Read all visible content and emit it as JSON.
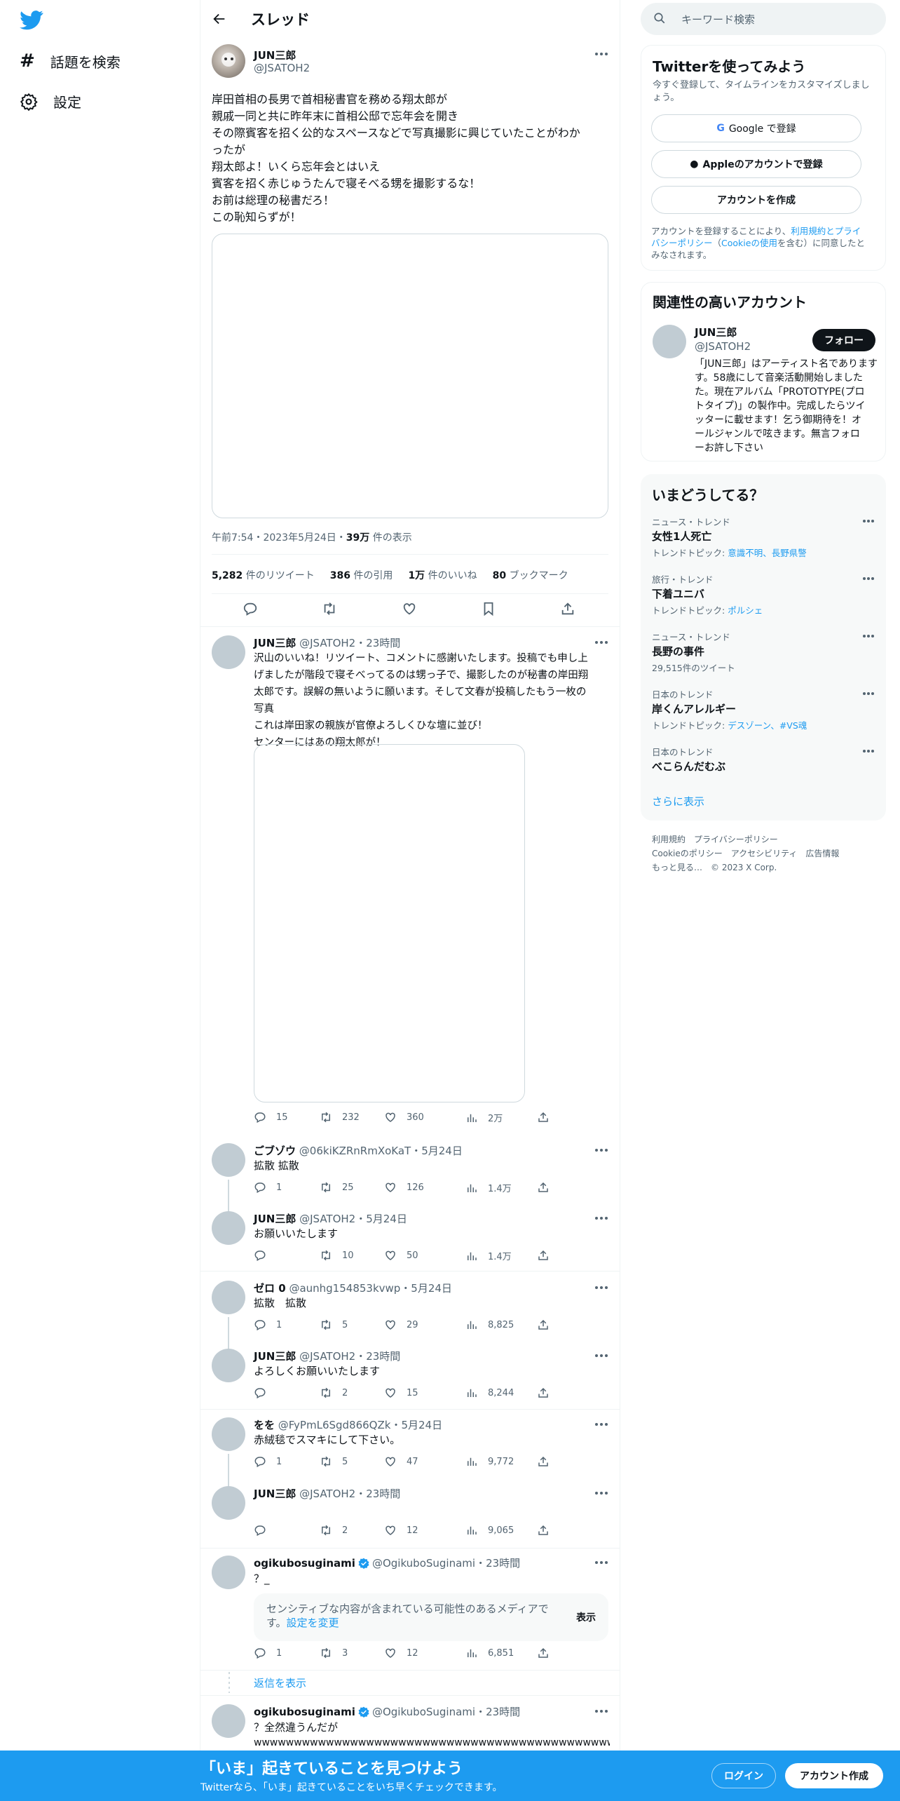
{
  "colors": {
    "accent": "#1d9bf0",
    "text": "#0f1419",
    "muted": "#536471",
    "border": "#eff3f4",
    "bottom_bar": "#1d9bf0"
  },
  "nav": {
    "explore": "話題を検索",
    "settings": "設定"
  },
  "header": {
    "title": "スレッド"
  },
  "main_tweet": {
    "name": "JUN三郎",
    "handle": "@JSATOH2",
    "lines": [
      "岸田首相の長男で首相秘書官を務める翔太郎が",
      "親戚一同と共に昨年末に首相公邸で忘年会を開き",
      "その際賓客を招く公的なスペースなどで写真撮影に興じていたことがわか",
      "ったが",
      "翔太郎よ！いくら忘年会とはいえ",
      "賓客を招く赤じゅうたんで寝そべる甥を撮影するな！",
      "お前は総理の秘書だろ！",
      "この恥知らずが！"
    ],
    "time": "午前7:54・2023年5月24日・",
    "views_num": "39万",
    "views_label": " 件の表示",
    "stats": [
      {
        "num": "5,282",
        "label": " 件のリツイート"
      },
      {
        "num": "386",
        "label": " 件の引用"
      },
      {
        "num": "1万",
        "label": " 件のいいね"
      },
      {
        "num": "80",
        "label": " ブックマーク"
      }
    ]
  },
  "replies": [
    {
      "name": "JUN三郎",
      "meta": "@JSATOH2・23時間",
      "lines": [
        "沢山のいいね！リツイート、コメントに感謝いたします。投稿でも申し上",
        "げましたが階段で寝そべってるのは甥っ子で、撮影したのが秘書の岸田翔",
        "太郎です。誤解の無いように願います。そして文春が投稿したもう一枚の",
        "写真",
        "これは岸田家の親族が官僚よろしくひな壇に並び！",
        "センターにはあの翔太郎が！"
      ],
      "reply": "15",
      "rt": "232",
      "like": "360",
      "views": "2万"
    },
    {
      "name": "ごブゾウ",
      "meta": "@06kiKZRnRmXoKaT・5月24日",
      "lines": [
        "拡散 拡散"
      ],
      "reply": "1",
      "rt": "25",
      "like": "126",
      "views": "1.4万"
    },
    {
      "name": "JUN三郎",
      "meta": "@JSATOH2・5月24日",
      "lines": [
        "お願いいたします"
      ],
      "reply": "",
      "rt": "10",
      "like": "50",
      "views": "1.4万"
    },
    {
      "name": "ゼロ 0",
      "meta": "@aunhg154853kvwp・5月24日",
      "lines": [
        "拡散　拡散"
      ],
      "reply": "1",
      "rt": "5",
      "like": "29",
      "views": "8,825"
    },
    {
      "name": "JUN三郎",
      "meta": "@JSATOH2・23時間",
      "lines": [
        "よろしくお願いいたします"
      ],
      "reply": "",
      "rt": "2",
      "like": "15",
      "views": "8,244"
    },
    {
      "name": "をを",
      "meta": "@FyPmL6Sgd866QZk・5月24日",
      "lines": [
        "赤絨毯でスマキにして下さい。"
      ],
      "reply": "1",
      "rt": "5",
      "like": "47",
      "views": "9,772"
    },
    {
      "name": "JUN三郎",
      "meta": "@JSATOH2・23時間",
      "lines": [],
      "reply": "",
      "rt": "2",
      "like": "12",
      "views": "9,065"
    },
    {
      "name": "ogikubosuginami",
      "meta": "@OgikuboSuginami・23時間",
      "lines": [
        "？_"
      ],
      "reply": "1",
      "rt": "3",
      "like": "12",
      "views": "6,851"
    },
    {
      "name": "ogikubosuginami",
      "meta": "@OgikuboSuginami・23時間",
      "lines": [
        "？全然違うんだが",
        "wwwwwwwwwwwwwwwwwwwwwwwwwwwwwwwwwwwwwwwwwwwwwwww"
      ]
    }
  ],
  "sensitive": {
    "line1": "センシティブな内容が含まれている可能性のあるメディアで",
    "line2_prefix": "す。",
    "line2_link": "設定を変更",
    "show": "表示"
  },
  "show_replies": "返信を表示",
  "sidebar": {
    "search_placeholder": "キーワード検索",
    "signup": {
      "title": "Twitterを使ってみよう",
      "subtitle": "今すぐ登録して、タイムラインをカスタマイズしましょう。",
      "google": "Google で登録",
      "apple": "Appleのアカウントで登録",
      "create": "アカウントを作成",
      "legal": {
        "l1a": "アカウントを登録することにより、",
        "l1b": "利用規約",
        "l1c": "とプライ",
        "l2a": "バシーポリシー",
        "l2b": "（",
        "l2c": "Cookieの使用",
        "l2d": "を含む）に同意したと",
        "l3": "みなされます。"
      }
    },
    "relevant": {
      "title": "関連性の高いアカウント",
      "name": "JUN三郎",
      "handle": "@JSATOH2",
      "follow": "フォロー",
      "bio": [
        "「JUN三郎」はアーティスト名であります",
        "す。58歳にして音楽活動開始しました",
        "た。現在アルバム「PROTOTYPE(プロ",
        "トタイプ)」の製作中。完成したらツイ",
        "ッターに載せます！乞う御期待を！オ",
        "ールジャンルで呟きます。無言フォロ",
        "ーお許し下さい"
      ]
    },
    "trends": {
      "title": "いまどうしてる？",
      "items": [
        {
          "ctx": "ニュース・トレンド",
          "name": "女性1人死亡",
          "sub_label": "トレンドトピック: ",
          "sub_link": "意識不明、長野県警"
        },
        {
          "ctx": "旅行・トレンド",
          "name": "下着ユニバ",
          "sub_label": "トレンドトピック: ",
          "sub_link": "ポルシェ"
        },
        {
          "ctx": "ニュース・トレンド",
          "name": "長野の事件",
          "sub_label": "29,515件のツイート",
          "sub_link": ""
        },
        {
          "ctx": "日本のトレンド",
          "name": "岸くんアレルギー",
          "sub_label": "トレンドトピック: ",
          "sub_link": "デスゾーン、#VS魂"
        },
        {
          "ctx": "日本のトレンド",
          "name": "べこらんだむぶ",
          "sub_label": "",
          "sub_link": ""
        }
      ],
      "show_more": "さらに表示"
    },
    "footer": {
      "l1": "利用規約　プライバシーポリシー",
      "l2": "Cookieのポリシー　アクセシビリティ　広告情報",
      "l3": "もっと見る…　© 2023 X Corp."
    }
  },
  "bottom_bar": {
    "title": "「いま」起きていることを見つけよう",
    "subtitle": "Twitterなら、「いま」起きていることをいち早くチェックできます。",
    "login": "ログイン",
    "signup": "アカウント作成"
  }
}
